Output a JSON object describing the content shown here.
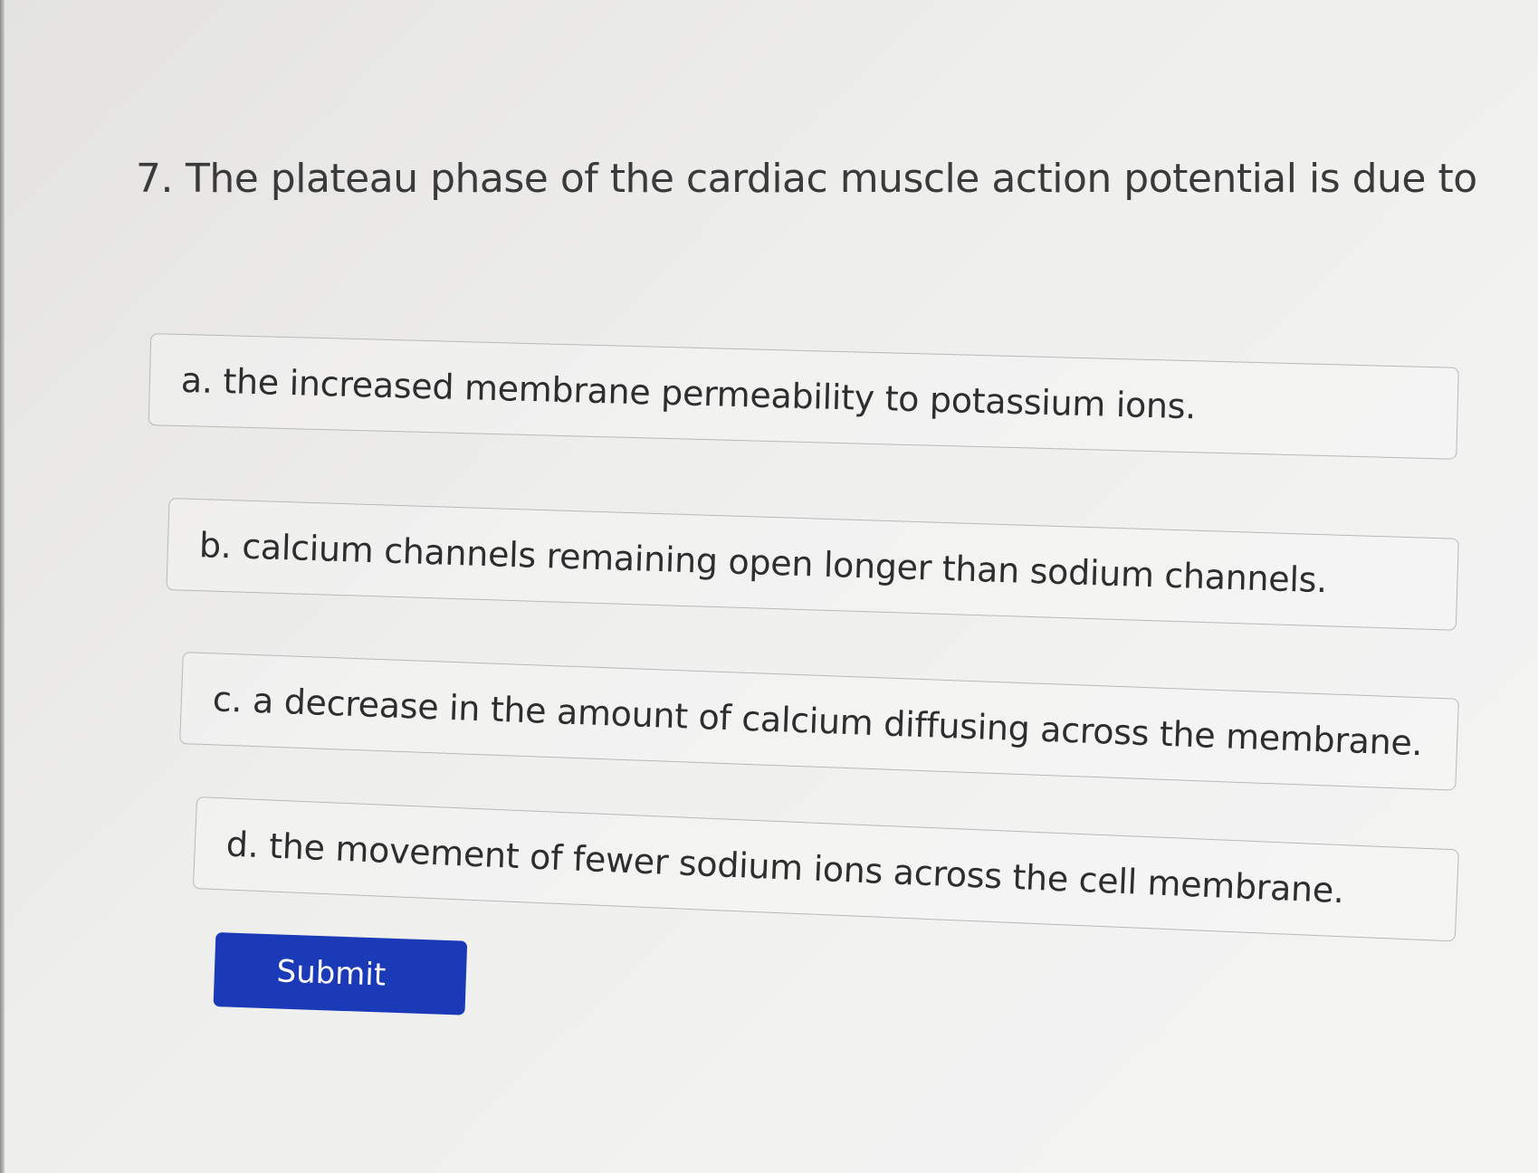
{
  "question": {
    "number": "7.",
    "text": "The plateau phase of the cardiac muscle action potential is due to"
  },
  "options": [
    {
      "letter": "a.",
      "text": "the increased membrane permeability to potassium ions."
    },
    {
      "letter": "b.",
      "text": "calcium channels remaining open longer than sodium channels."
    },
    {
      "letter": "c.",
      "text": "a decrease in the amount of calcium diffusing across the membrane."
    },
    {
      "letter": "d.",
      "text": "the movement of fewer sodium ions across the cell membrane."
    }
  ],
  "submit": {
    "label": "Submit"
  },
  "colors": {
    "submit_background": "#1a3ab8",
    "option_border": "#b9b9b9",
    "text": "#333333"
  }
}
